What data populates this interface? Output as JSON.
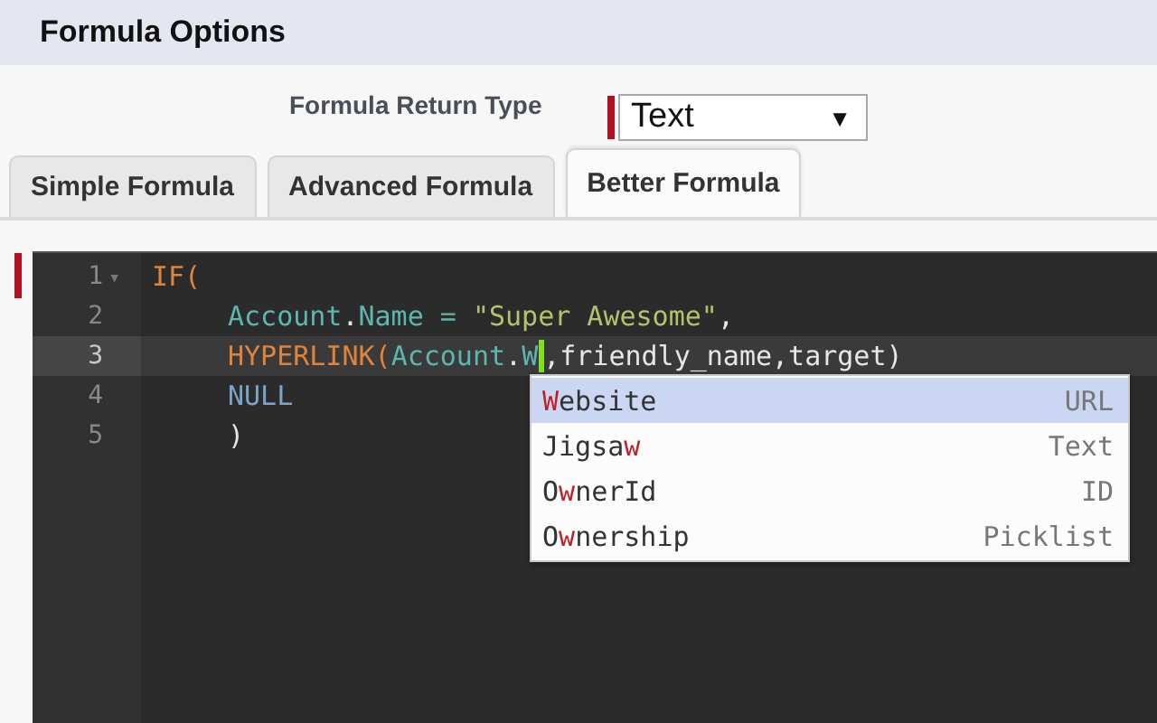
{
  "header": {
    "title": "Formula Options"
  },
  "return_type": {
    "label": "Formula Return Type",
    "required": true,
    "value": "Text",
    "arrow": "▼"
  },
  "tabs": [
    {
      "label": "Simple Formula",
      "selected": false
    },
    {
      "label": "Advanced Formula",
      "selected": false
    },
    {
      "label": "Better Formula",
      "selected": true
    }
  ],
  "editor": {
    "required": true,
    "lines": [
      {
        "number": "1",
        "fold": "▾",
        "active": false,
        "tokens": [
          {
            "kind": "keyword",
            "text": "IF("
          }
        ]
      },
      {
        "number": "2",
        "active": false,
        "indented": true,
        "tokens": [
          {
            "kind": "field",
            "text": "Account"
          },
          {
            "kind": "plain",
            "text": "."
          },
          {
            "kind": "field",
            "text": "Name"
          },
          {
            "kind": "field",
            "text": " = "
          },
          {
            "kind": "string",
            "text": "\"Super Awesome\""
          },
          {
            "kind": "plain",
            "text": ","
          }
        ]
      },
      {
        "number": "3",
        "active": true,
        "indented": true,
        "tokens": [
          {
            "kind": "keyword",
            "text": "HYPERLINK("
          },
          {
            "kind": "field",
            "text": "Account"
          },
          {
            "kind": "plain",
            "text": "."
          },
          {
            "kind": "field",
            "text": "W"
          },
          {
            "kind": "cursor"
          },
          {
            "kind": "plain",
            "text": ",friendly_name,target)"
          }
        ]
      },
      {
        "number": "4",
        "active": false,
        "indented": true,
        "tokens": [
          {
            "kind": "constant",
            "text": "NULL"
          }
        ]
      },
      {
        "number": "5",
        "active": false,
        "indented": true,
        "tokens": [
          {
            "kind": "plain",
            "text": ")"
          }
        ]
      }
    ],
    "suggestions": [
      {
        "selected": true,
        "type": "URL",
        "segments": [
          {
            "text": "W",
            "match": true
          },
          {
            "text": "ebsite",
            "match": false
          }
        ]
      },
      {
        "selected": false,
        "type": "Text",
        "segments": [
          {
            "text": "Jigsa",
            "match": false
          },
          {
            "text": "w",
            "match": true
          }
        ]
      },
      {
        "selected": false,
        "type": "ID",
        "segments": [
          {
            "text": "O",
            "match": false
          },
          {
            "text": "w",
            "match": true
          },
          {
            "text": "nerId",
            "match": false
          }
        ]
      },
      {
        "selected": false,
        "type": "Picklist",
        "segments": [
          {
            "text": "O",
            "match": false
          },
          {
            "text": "w",
            "match": true
          },
          {
            "text": "nership",
            "match": false
          }
        ]
      }
    ]
  }
}
